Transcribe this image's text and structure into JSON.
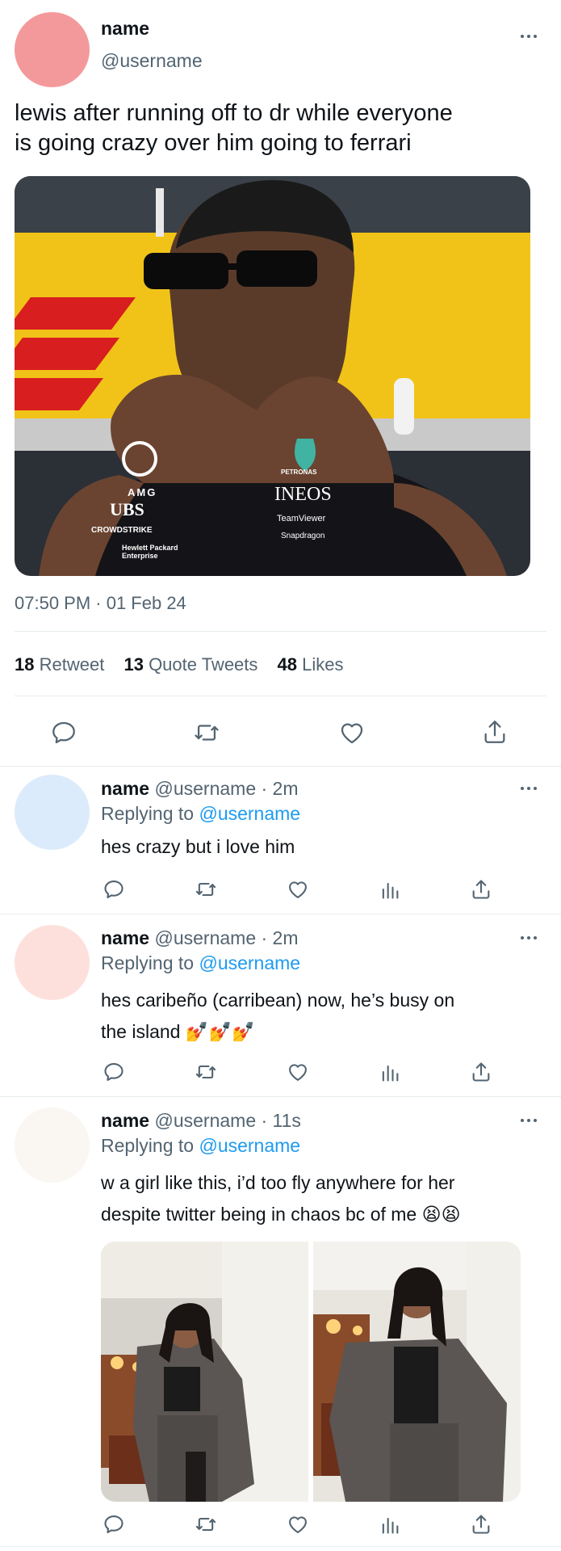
{
  "main_tweet": {
    "name": "name",
    "handle": "@username",
    "text_line1": "lewis after running off to dr while everyone",
    "text_line2": "is going crazy over him going to ferrari",
    "timestamp": "07:50 PM · 01 Feb 24",
    "stats": {
      "retweets_count": "18",
      "retweets_label": "Retweet",
      "quotes_count": "13",
      "quotes_label": "Quote Tweets",
      "likes_count": "48",
      "likes_label": "Likes"
    },
    "image_badges": {
      "amg": "AMG",
      "petronas": "PETRONAS",
      "ubs": "UBS",
      "ineos": "INEOS",
      "crowdstrike": "CROWDSTRIKE",
      "teamviewer": "TeamViewer",
      "snapdragon": "Snapdragon",
      "hp_line1": "Hewlett Packard",
      "hp_line2": "Enterprise"
    }
  },
  "colors": {
    "avatar_main": "#f4999b",
    "avatar_reply1": "#dcebfb",
    "avatar_reply2": "#fde0dc",
    "avatar_reply3": "#faf6f2",
    "link": "#1d9bf0",
    "muted": "#536471",
    "divider": "#e6ecf0"
  },
  "replies": [
    {
      "name": "name",
      "handle_time": "@username · 2m",
      "replying_prefix": "Replying to",
      "replying_to": "@username",
      "text_lines": [
        "hes crazy but i love him"
      ]
    },
    {
      "name": "name",
      "handle_time": "@username · 2m",
      "replying_prefix": "Replying to",
      "replying_to": "@username",
      "text_lines": [
        "hes caribeño (carribean) now, he’s busy on",
        "the island"
      ],
      "emoji": "💅💅💅"
    },
    {
      "name": "name",
      "handle_time": "@username · 11s",
      "replying_prefix": "Replying to",
      "replying_to": "@username",
      "text_lines": [
        "w a girl like this, i’d too fly anywhere for her",
        "despite twitter being in chaos bc of me"
      ],
      "emoji": "😫😫"
    }
  ],
  "icons": [
    "reply-icon",
    "retweet-icon",
    "like-icon",
    "views-icon",
    "share-icon",
    "more-icon"
  ]
}
